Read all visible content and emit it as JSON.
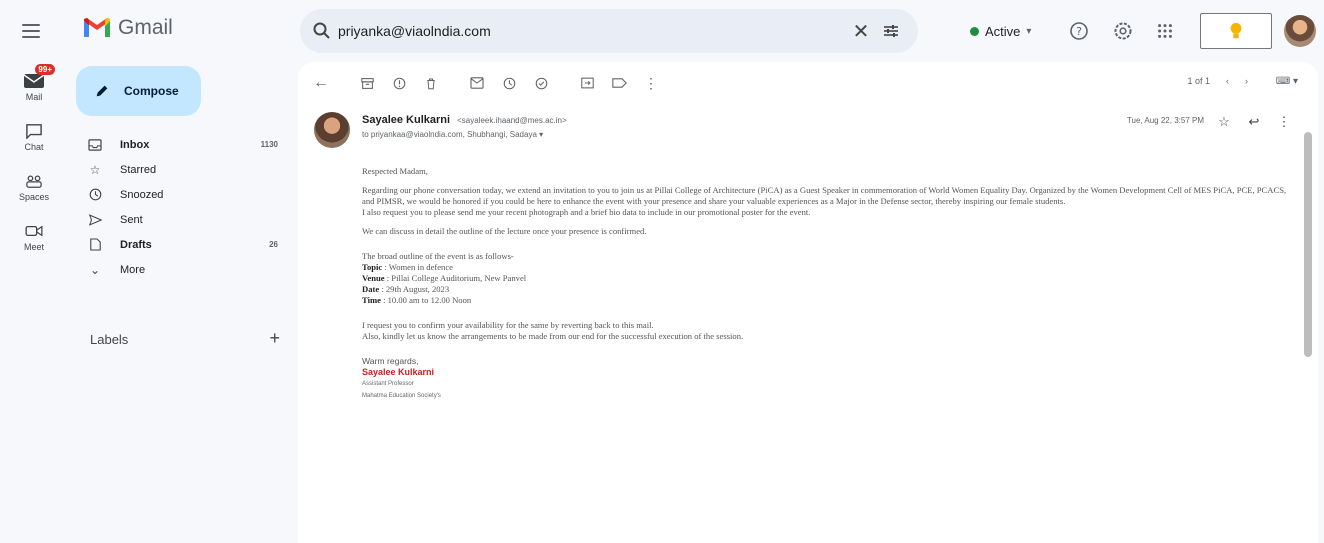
{
  "app": {
    "name": "Gmail"
  },
  "search": {
    "value": "priyanka@viaolndia.com"
  },
  "status": {
    "label": "Active"
  },
  "rail": [
    {
      "label": "Mail",
      "badge": "99+"
    },
    {
      "label": "Chat"
    },
    {
      "label": "Spaces"
    },
    {
      "label": "Meet"
    }
  ],
  "compose": {
    "label": "Compose"
  },
  "nav": [
    {
      "label": "Inbox",
      "count": "1130",
      "bold": true
    },
    {
      "label": "Starred",
      "count": ""
    },
    {
      "label": "Snoozed",
      "count": ""
    },
    {
      "label": "Sent",
      "count": ""
    },
    {
      "label": "Drafts",
      "count": "26",
      "bold": true
    },
    {
      "label": "More",
      "count": ""
    }
  ],
  "labels": {
    "title": "Labels",
    "add": "+"
  },
  "toolbar": {
    "pager": "1 of 1"
  },
  "message": {
    "sender_name": "Sayalee Kulkarni",
    "sender_email": "<sayaleek.ihaand@mes.ac.in>",
    "to_line": "to priyankaa@viaolndia.com, Shubhangi, Sadaya ▾",
    "date": "Tue, Aug 22, 3:57 PM",
    "greeting": "Respected Madam,",
    "para1": "Regarding our phone conversation today, we extend an invitation to you to join us at Pillai College of Architecture (PiCA) as a Guest Speaker in commemoration of World Women Equality Day. Organized by the Women Development Cell of MES PiCA, PCE, PCACS, and PIMSR, we would be honored if you could be here to enhance the event with your presence and share your valuable experiences as a Major in the Defense sector, thereby inspiring our female students.",
    "para2": "I also request you to please send me your recent photograph and a brief bio data to include in our promotional poster for the event.",
    "para3": "We can discuss in detail the outline of the lecture once your presence is confirmed.",
    "outline_intro": "The broad outline of the event is as follows-",
    "topic_label": "Topic",
    "topic_value": ": Women in defence",
    "venue_label": "Venue",
    "venue_value": ": Pillai College Auditorium, New Panvel",
    "date_label": "Date",
    "date_value": ": 29th August, 2023",
    "time_label": "Time",
    "time_value": ": 10.00 am to 12.00 Noon",
    "para4a": "I request you to confirm your availability for the same by reverting back to this mail.",
    "para4b": "Also, kindly let us know the arrangements to be made from our end for the successful execution of the session.",
    "closing": "Warm regards,",
    "sig_name": "Sayalee Kulkarni",
    "sig_title": "Assistant Professor",
    "sig_org": "Mahatma Education Society's"
  }
}
